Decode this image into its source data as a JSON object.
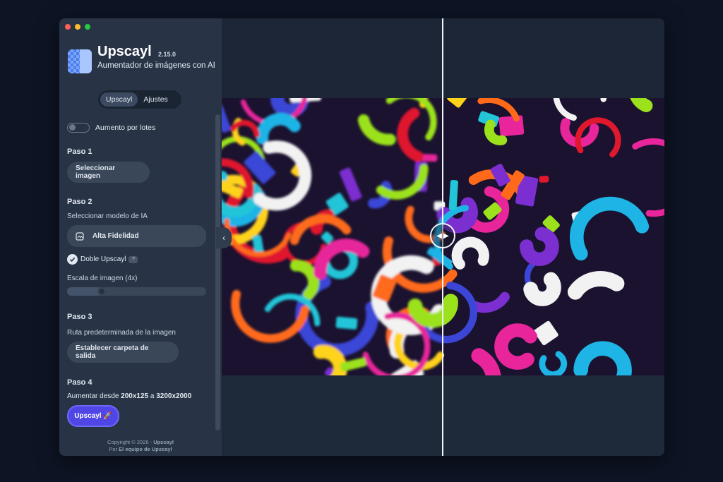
{
  "app": {
    "name": "Upscayl",
    "version": "2.15.0",
    "subtitle": "Aumentador de imágenes con AI"
  },
  "tabs": [
    {
      "label": "Upscayl",
      "active": true
    },
    {
      "label": "Ajustes",
      "active": false
    }
  ],
  "batch": {
    "label": "Aumento por lotes",
    "enabled": false
  },
  "step1": {
    "title": "Paso 1",
    "button": "Seleccionar imagen"
  },
  "step2": {
    "title": "Paso 2",
    "model_label": "Seleccionar modelo de IA",
    "model_value": "Alta Fidelidad",
    "double_label": "Doble Upscayl",
    "double_checked": true,
    "help": "?",
    "scale_label": "Escala de imagen (4x)",
    "scale_fraction": 0.22
  },
  "step3": {
    "title": "Paso 3",
    "path_label": "Ruta predeterminada de la imagen",
    "button": "Establecer carpeta de salida"
  },
  "step4": {
    "title": "Paso 4",
    "prefix": "Aumentar desde ",
    "from": "200x125",
    "middle": " a ",
    "to": "3200x2000",
    "button": "Upscayl 🚀"
  },
  "footer": {
    "copy_prefix": "Copyright © 2026 - ",
    "copy_brand": "Upscayl",
    "by_prefix": "Por ",
    "by_team": "El equipo de Upscayl"
  },
  "colors": {
    "accent": "#4f46e5",
    "sidebar": "#283446",
    "background": "#0d1424"
  },
  "icons": {
    "collapse": "chevron-left-icon",
    "more": "ellipsis-icon",
    "compare": "compare-arrows-icon"
  }
}
